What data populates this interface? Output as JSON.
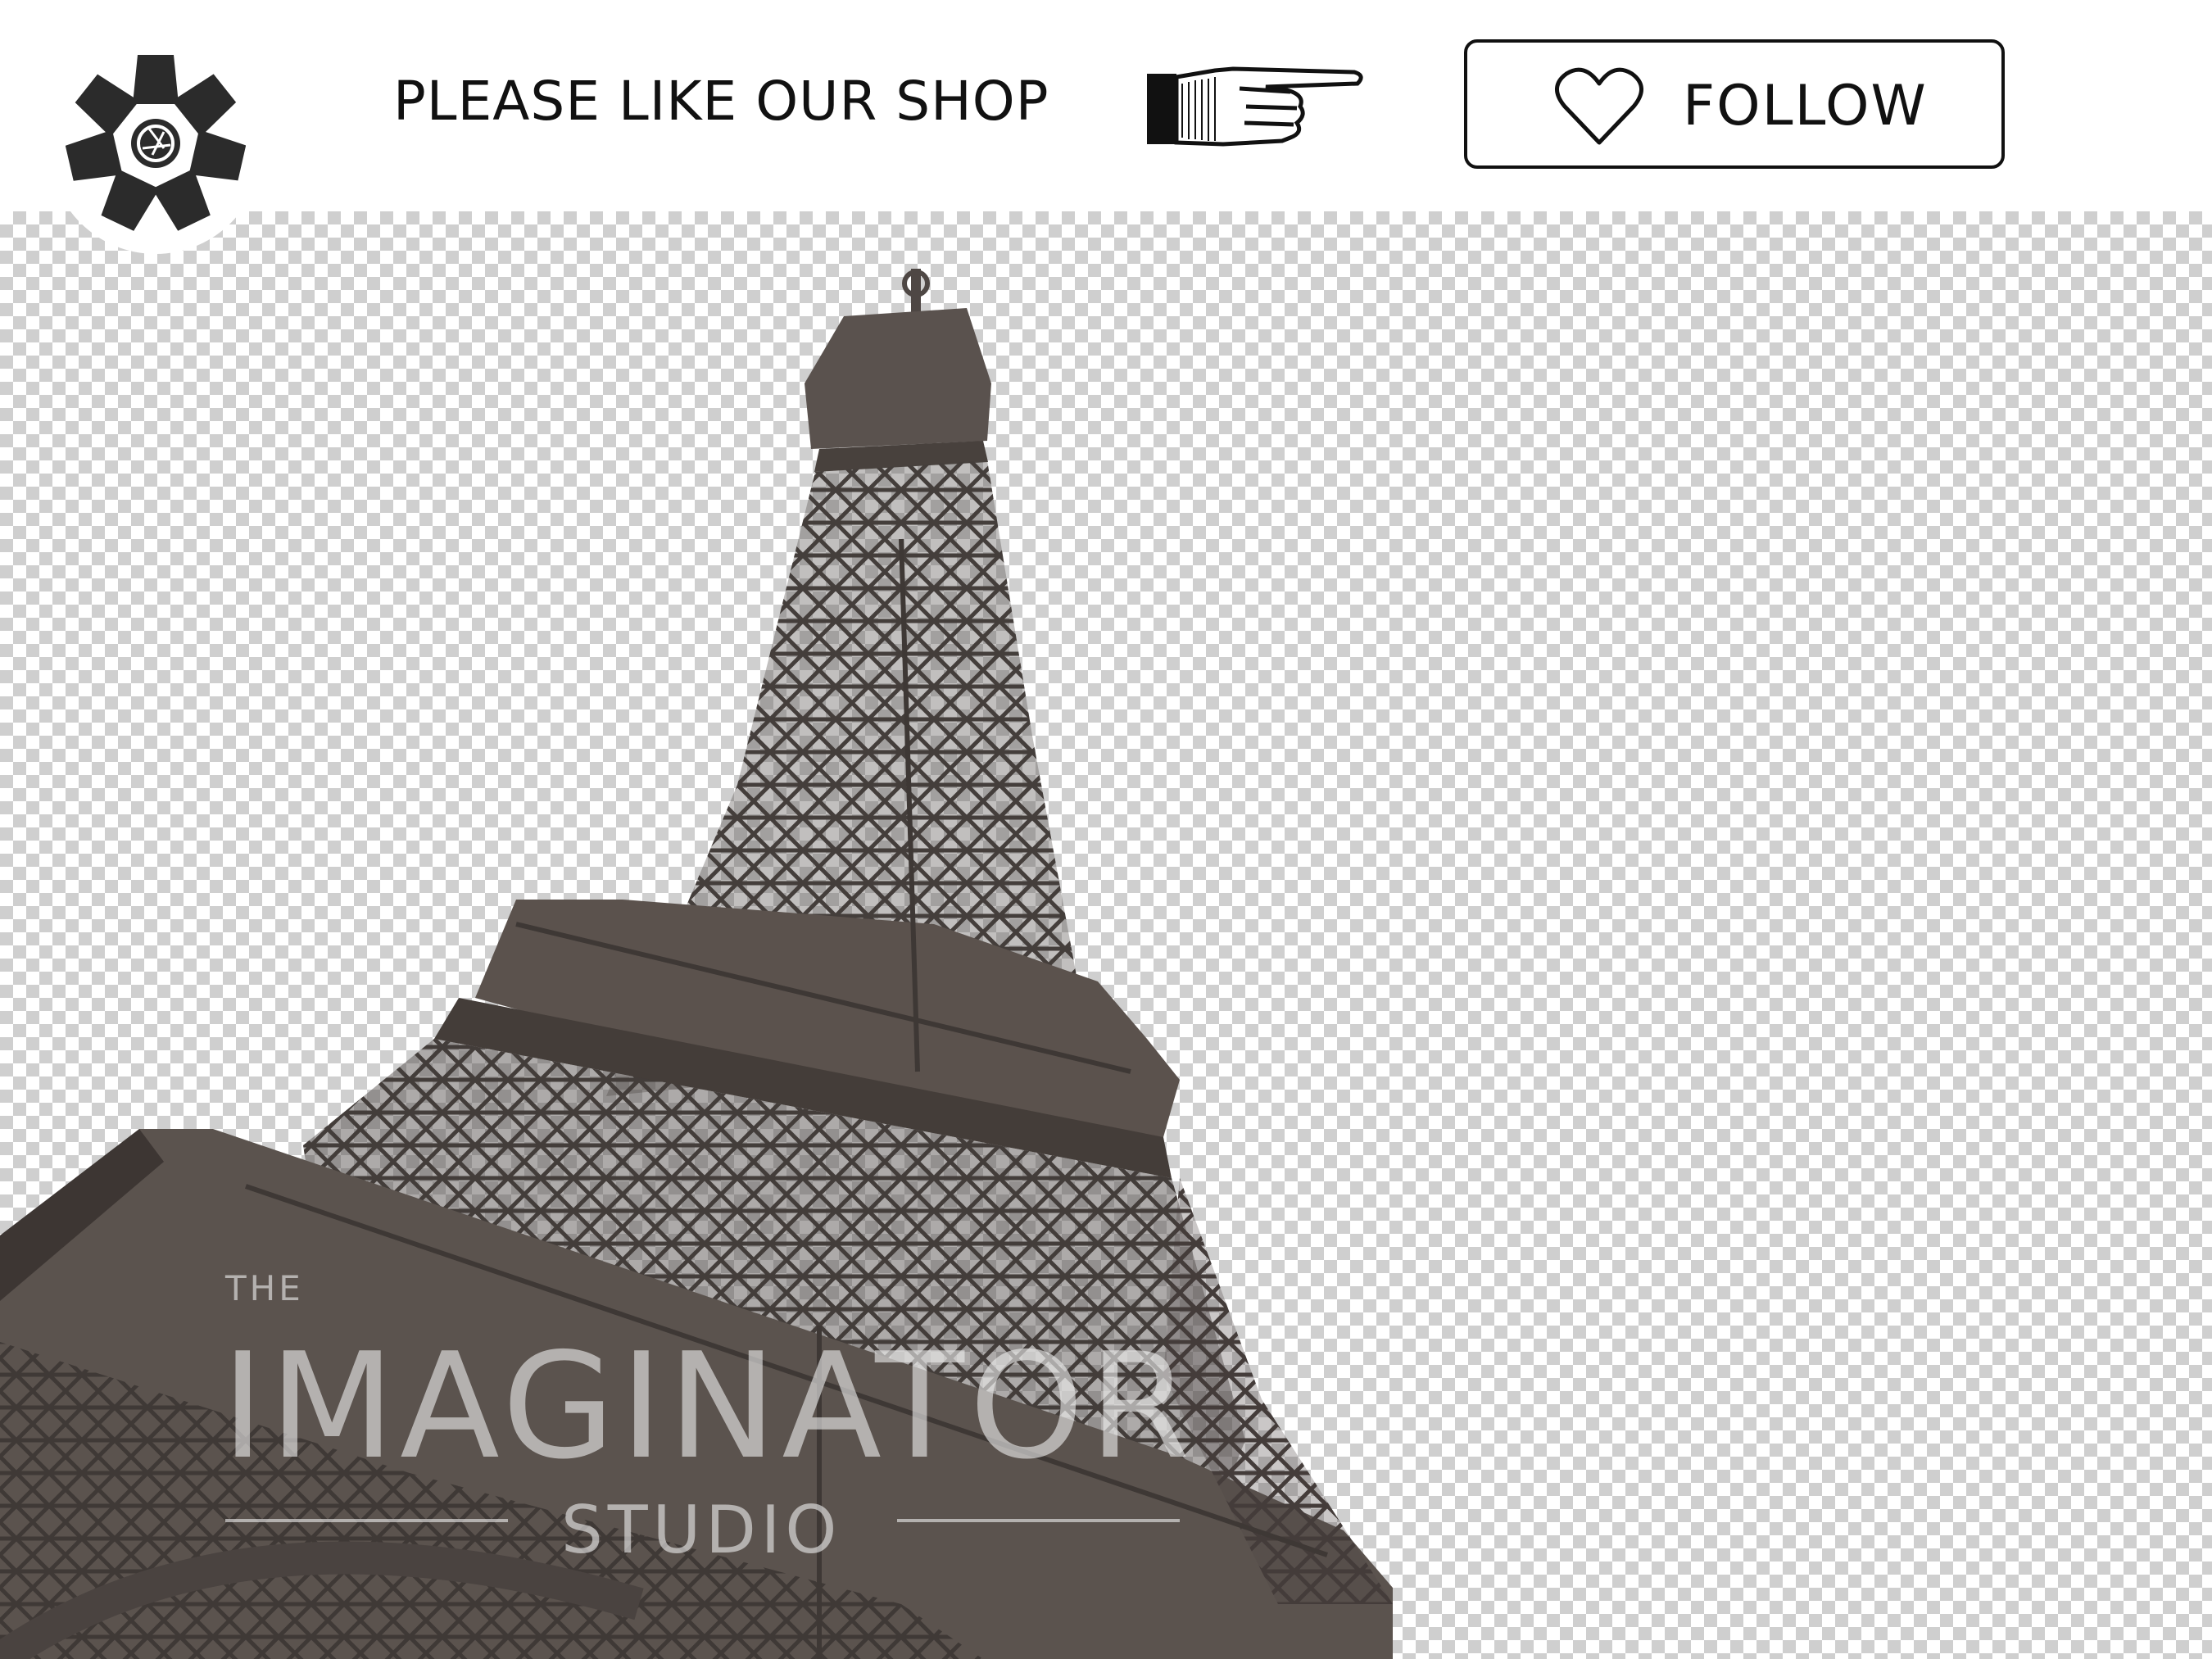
{
  "header": {
    "logo_icon": "camera-aperture-flower-logo",
    "tagline": "PLEASE LIKE OUR SHOP",
    "pointer_icon": "pointing-hand-icon",
    "follow_button": {
      "icon": "heart-icon",
      "label": "FOLLOW"
    }
  },
  "canvas": {
    "background": "transparency-checkerboard",
    "subject": "eiffel-tower",
    "watermark": {
      "top": "THE",
      "main": "IMAGINATOR",
      "bottom": "STUDIO"
    }
  },
  "colors": {
    "text": "#111111",
    "tower": "#4e4744",
    "checker_dark": "#cfcfcf",
    "checker_light": "#ffffff"
  }
}
